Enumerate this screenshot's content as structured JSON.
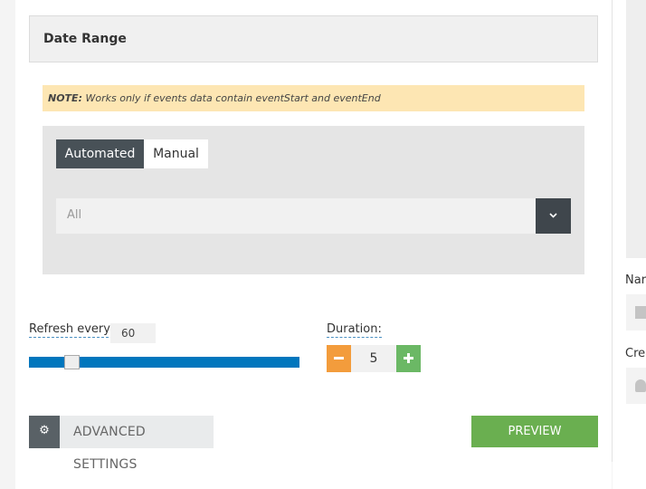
{
  "section": {
    "title": "Date Range"
  },
  "note": {
    "label": "NOTE:",
    "text": " Works only if events data contain eventStart and eventEnd"
  },
  "tabs": [
    {
      "label": "Automated",
      "active": true
    },
    {
      "label": "Manual",
      "active": false
    }
  ],
  "select": {
    "value": "All"
  },
  "refresh": {
    "label": "Refresh every:",
    "value": "60",
    "slider_fraction": 0.14
  },
  "duration": {
    "label": "Duration:",
    "value": "5"
  },
  "buttons": {
    "advanced": "ADVANCED SETTINGS",
    "preview": "PREVIEW"
  },
  "right_panel": {
    "label1": "Nar",
    "label2": "Crea"
  },
  "colors": {
    "active_tab": "#485157",
    "slider": "#0076bd",
    "minus": "#f39c3c",
    "plus": "#6bb865",
    "preview": "#6aaf50",
    "note_bg": "#fde6b3"
  },
  "icons": {
    "select_arrow": "chevron-down-icon",
    "advanced": "gear-icon",
    "minus": "minus-icon",
    "plus": "plus-icon"
  }
}
